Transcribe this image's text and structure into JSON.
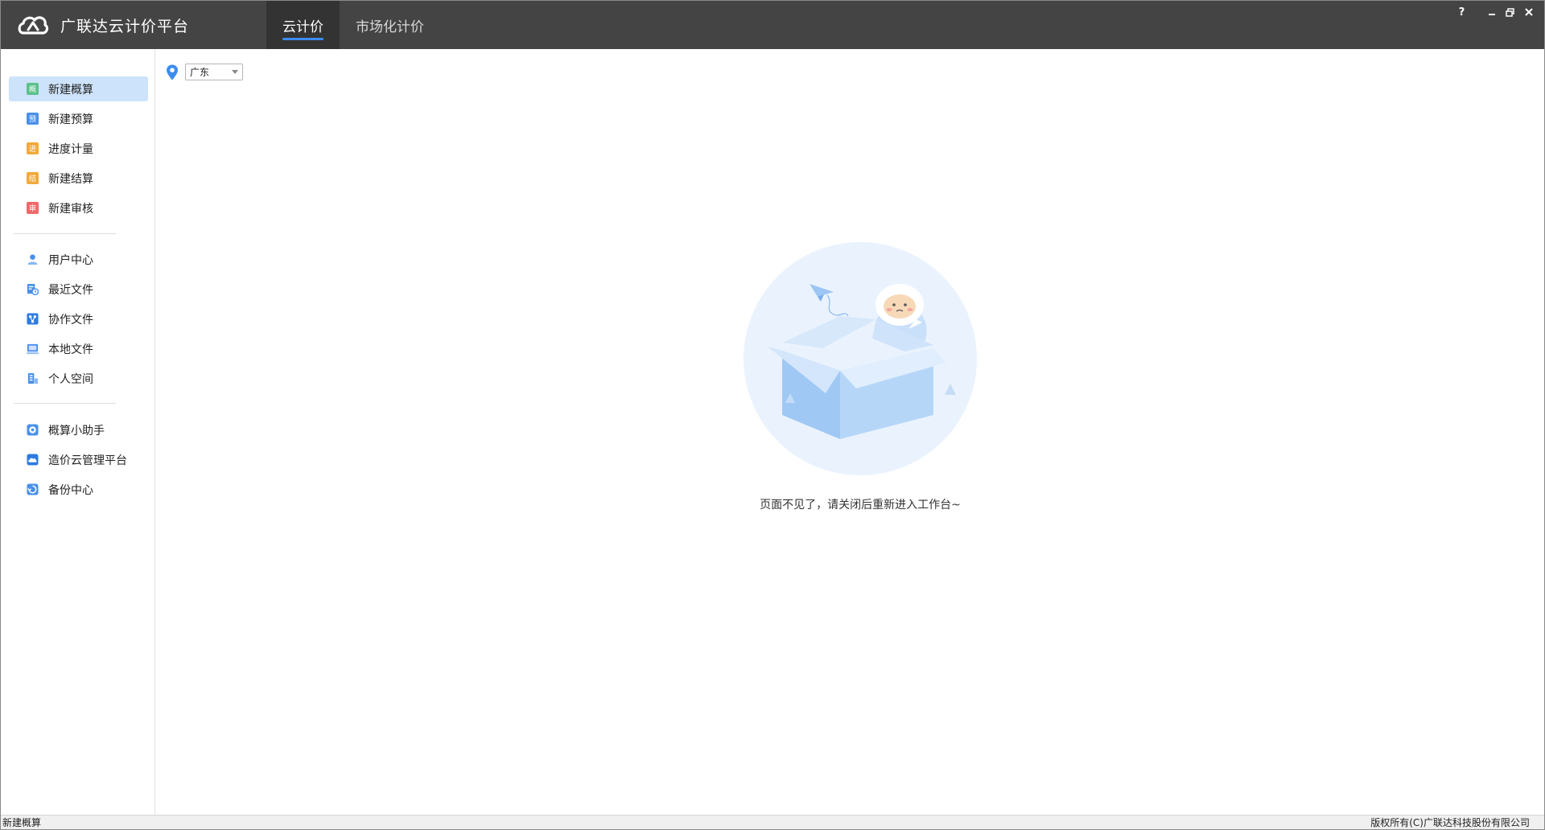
{
  "app": {
    "title": "广联达云计价平台"
  },
  "tabs": [
    {
      "label": "云计价",
      "active": true
    },
    {
      "label": "市场化计价",
      "active": false
    }
  ],
  "window_controls": {
    "help": "?",
    "minimize": "–",
    "restore": "❐",
    "close": "✕"
  },
  "sidebar": {
    "group1": [
      {
        "label": "新建概算",
        "icon": "estimate-icon",
        "glyph": "概",
        "color": "#5cc08a",
        "active": true
      },
      {
        "label": "新建预算",
        "icon": "budget-icon",
        "glyph": "预",
        "color": "#4a90e8",
        "active": false
      },
      {
        "label": "进度计量",
        "icon": "progress-icon",
        "glyph": "进",
        "color": "#f2a93b",
        "active": false
      },
      {
        "label": "新建结算",
        "icon": "settlement-icon",
        "glyph": "结",
        "color": "#f2a93b",
        "active": false
      },
      {
        "label": "新建审核",
        "icon": "audit-icon",
        "glyph": "审",
        "color": "#f0686a",
        "active": false
      }
    ],
    "group2": [
      {
        "label": "用户中心",
        "icon": "user-icon",
        "color": "#4a90e8"
      },
      {
        "label": "最近文件",
        "icon": "recent-files-icon",
        "color": "#4a90e8"
      },
      {
        "label": "协作文件",
        "icon": "collaboration-icon",
        "color": "#2d7be0"
      },
      {
        "label": "本地文件",
        "icon": "local-files-icon",
        "color": "#4a90e8"
      },
      {
        "label": "个人空间",
        "icon": "personal-space-icon",
        "color": "#4a90e8"
      }
    ],
    "group3": [
      {
        "label": "概算小助手",
        "icon": "assistant-icon",
        "color": "#4a90e8"
      },
      {
        "label": "造价云管理平台",
        "icon": "cloud-platform-icon",
        "color": "#2d7be0"
      },
      {
        "label": "备份中心",
        "icon": "backup-icon",
        "color": "#4a90e8"
      }
    ]
  },
  "region": {
    "selected": "广东"
  },
  "empty_state": {
    "message": "页面不见了，请关闭后重新进入工作台~"
  },
  "statusbar": {
    "left": "新建概算",
    "right": "版权所有(C)广联达科技股份有限公司"
  },
  "colors": {
    "titlebar": "#444444",
    "active_tab": "#333333",
    "accent": "#3c8cf0",
    "sidebar_active": "#cde3fb"
  }
}
